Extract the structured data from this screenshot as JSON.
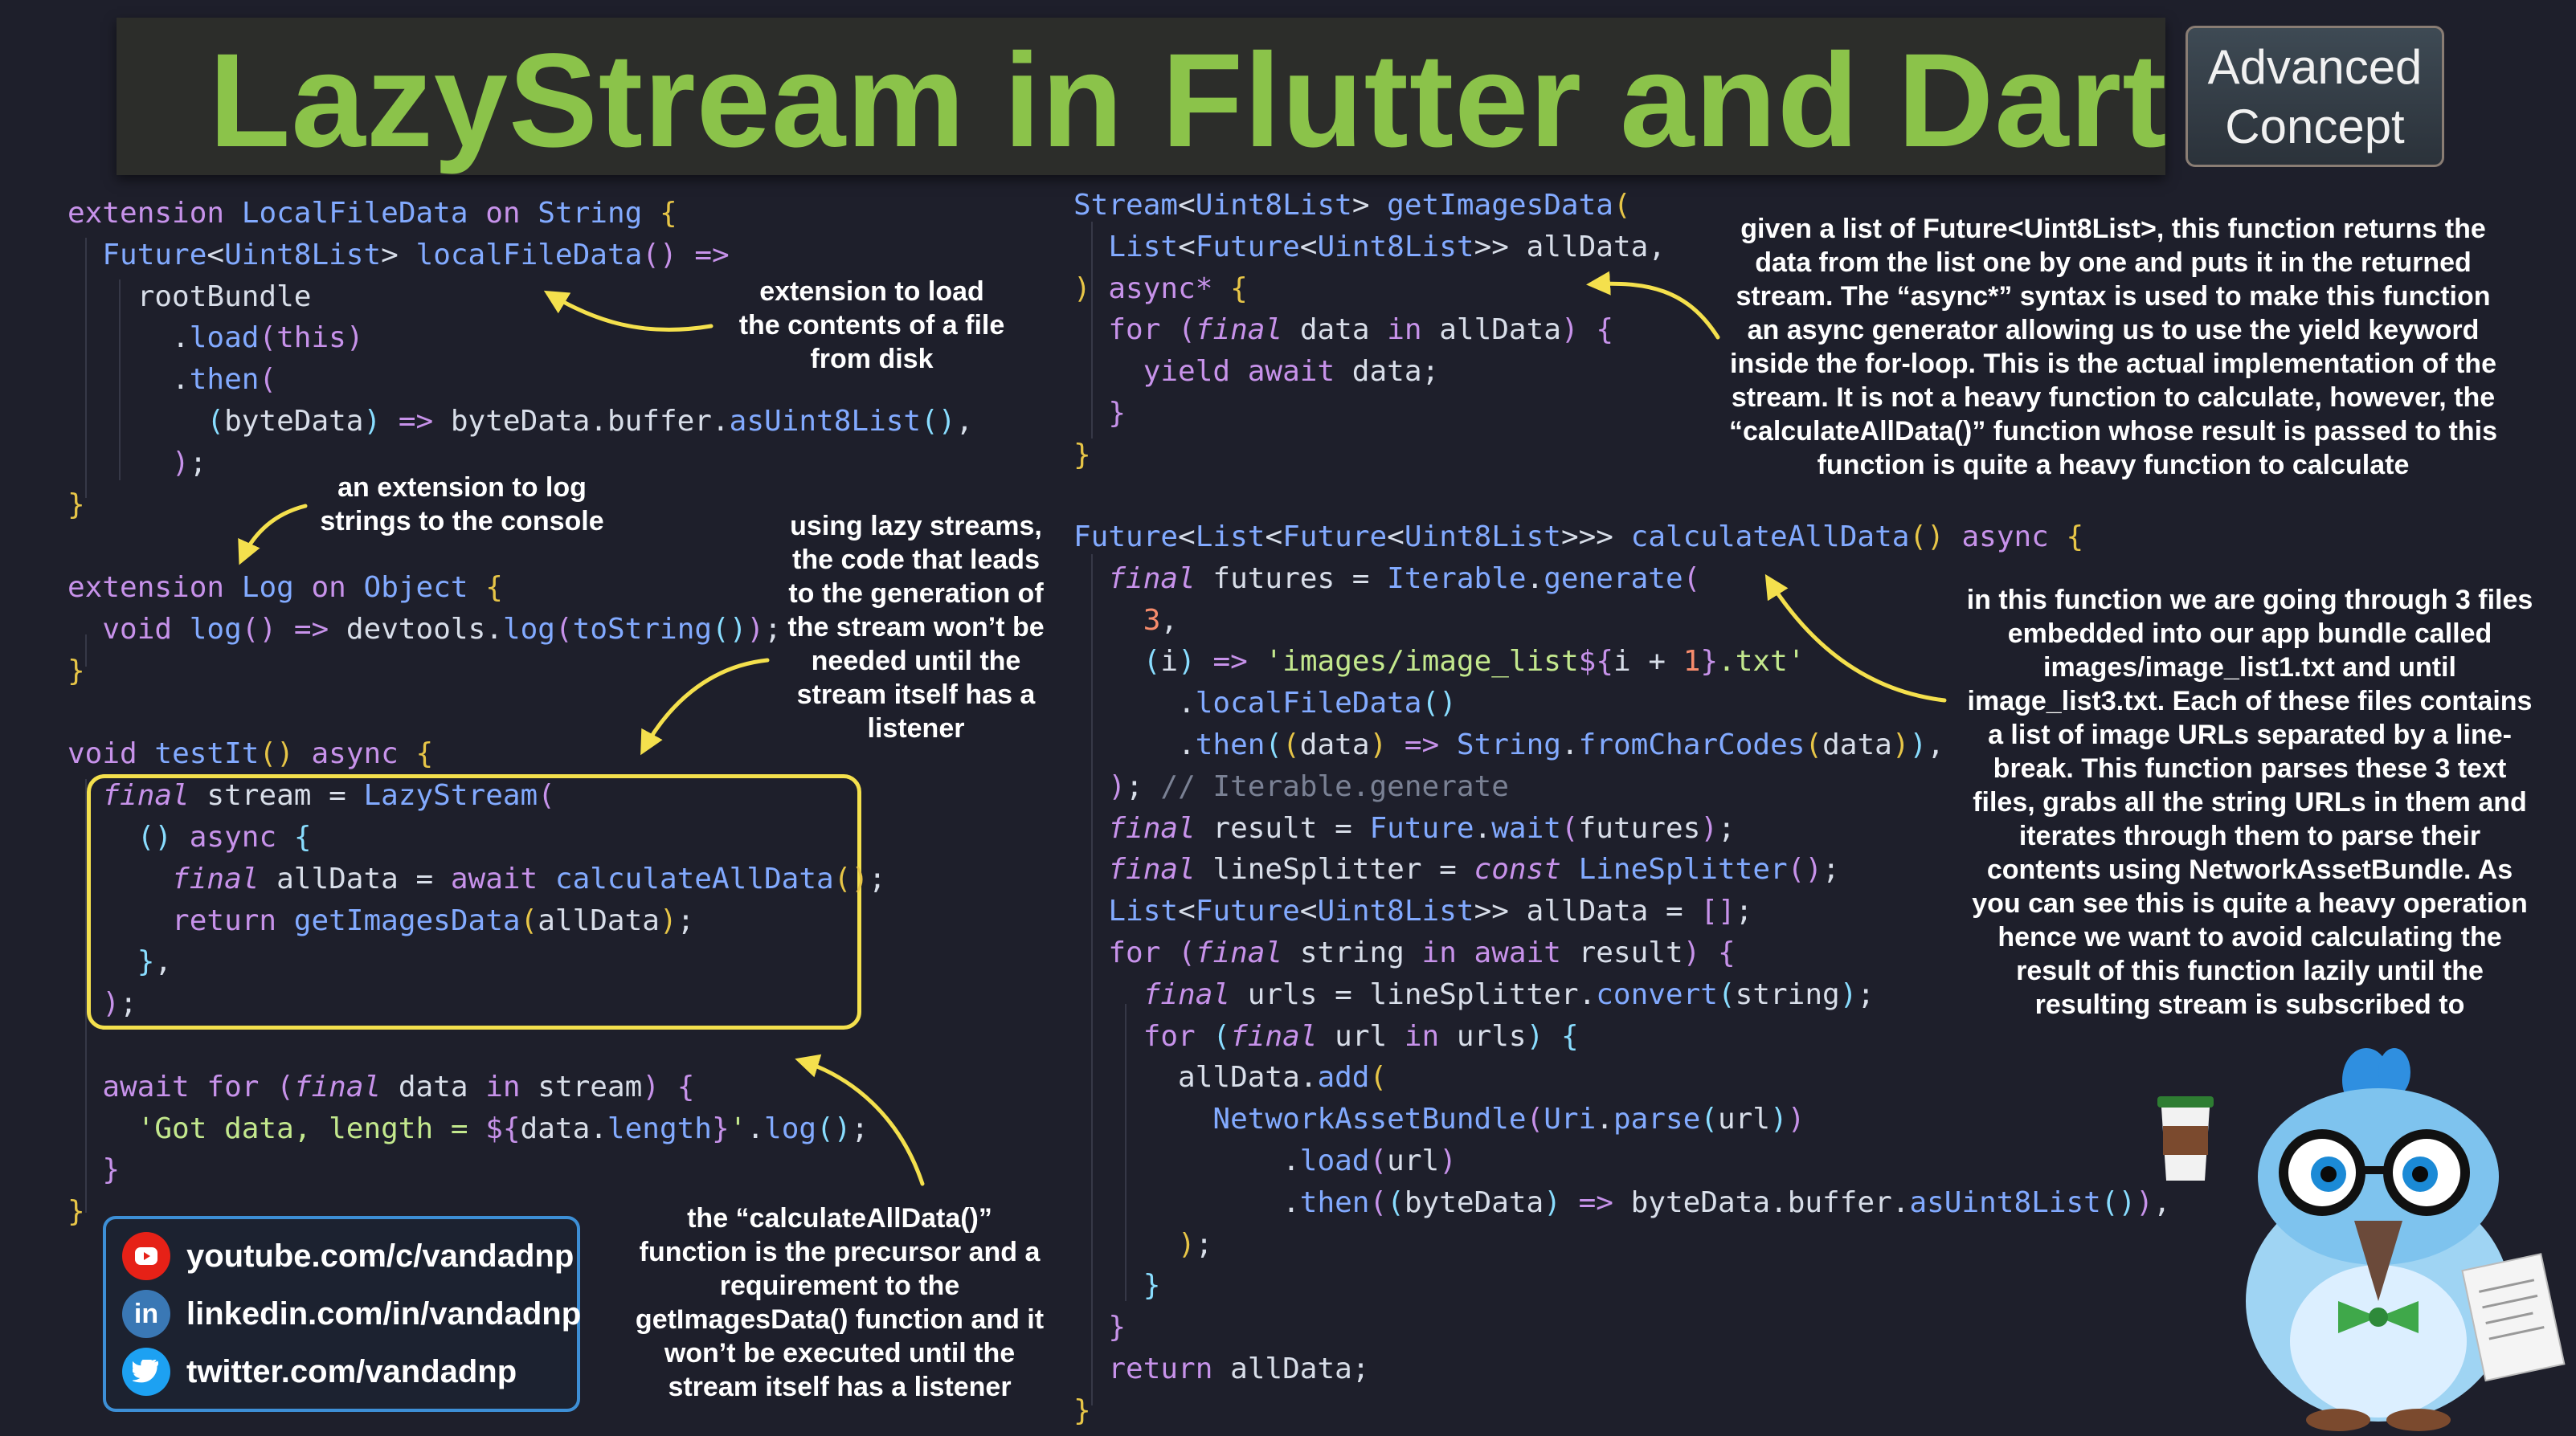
{
  "title": "LazyStream in Flutter and Dart",
  "badge": {
    "line1": "Advanced",
    "line2": "Concept"
  },
  "annotations": {
    "extension_load": [
      "extension to load",
      "the contents of a file",
      "from disk"
    ],
    "extension_log": [
      "an extension to log",
      "strings to the console"
    ],
    "lazy_streams": [
      "using lazy streams,",
      "the code that leads",
      "to the generation of",
      "the stream won’t be",
      "needed until the",
      "stream itself has a",
      "listener"
    ],
    "calculate_precursor": [
      "the “calculateAllData()”",
      "function is the precursor and a",
      "requirement to the",
      "getImagesData() function and it",
      "won’t be executed until the",
      "stream itself has a listener"
    ],
    "get_images_data": [
      "given a list of Future<Uint8List>, this function returns the",
      "data from the list one by one and puts it in the returned",
      "stream. The “async*” syntax is used to make this function",
      "an async generator allowing us to use the yield keyword",
      "inside the for-loop. This is the actual implementation of the",
      "stream. It is not a heavy function to calculate, however, the",
      "“calculateAllData()” function whose result is passed to this",
      "function is quite a heavy function to calculate"
    ],
    "calculate_all_data": [
      "in this function we are going through 3 files",
      "embedded into our app bundle called",
      "images/image_list1.txt and until",
      "image_list3.txt. Each of these files contains",
      "a list of image URLs separated by a line-",
      "break. This function parses these 3 text",
      "files, grabs all the string URLs in them and",
      "iterates through them to parse their",
      "contents using NetworkAssetBundle. As",
      "you can see this is quite a heavy operation",
      "hence we want to avoid calculating the",
      "result of this function lazily until the",
      "resulting stream is subscribed to"
    ]
  },
  "social": {
    "youtube": "youtube.com/c/vandadnp",
    "linkedin": "linkedin.com/in/vandadnp",
    "twitter": "twitter.com/vandadnp"
  },
  "icons": {
    "youtube": "youtube-icon",
    "linkedin": "linkedin-icon",
    "twitter": "twitter-icon"
  },
  "colors": {
    "title": "#8bc34a",
    "highlight_box": "#f4e04d",
    "arrow": "#f4e04d",
    "social_border": "#3d8fd6",
    "background": "#1e1f2b"
  }
}
